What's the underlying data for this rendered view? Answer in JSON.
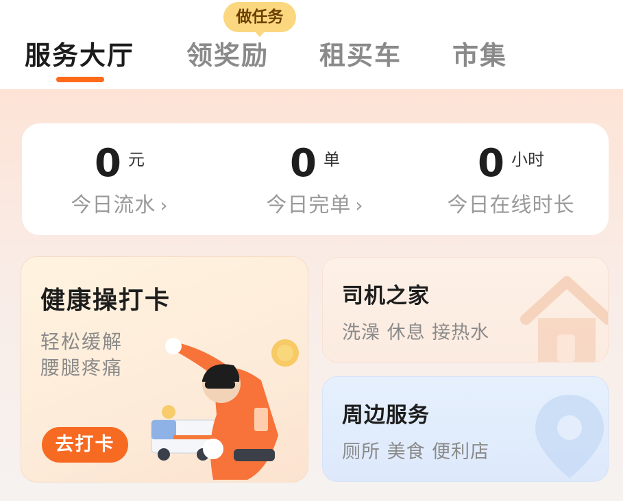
{
  "tabs": {
    "items": [
      {
        "label": "服务大厅"
      },
      {
        "label": "领奖励"
      },
      {
        "label": "租买车"
      },
      {
        "label": "市集"
      }
    ],
    "active_index": 0,
    "badge_label": "做任务"
  },
  "stats": [
    {
      "value": "0",
      "unit": "元",
      "label": "今日流水",
      "has_chevron": true
    },
    {
      "value": "0",
      "unit": "单",
      "label": "今日完单",
      "has_chevron": true
    },
    {
      "value": "0",
      "unit": "小时",
      "label": "今日在线时长",
      "has_chevron": false
    }
  ],
  "chevron_glyph": "›",
  "health_card": {
    "title": "健康操打卡",
    "subtitle_line1": "轻松缓解",
    "subtitle_line2": "腰腿疼痛",
    "button_label": "去打卡"
  },
  "driver_home_card": {
    "title": "司机之家",
    "subtitle": "洗澡 休息 接热水",
    "icon": "house-icon"
  },
  "nearby_card": {
    "title": "周边服务",
    "subtitle": "厕所 美食 便利店",
    "icon": "location-pin-icon"
  },
  "colors": {
    "accent": "#ff6a1a",
    "badge": "#fbd77f",
    "button": "#f76a22",
    "background_top": "#fde3d6"
  }
}
